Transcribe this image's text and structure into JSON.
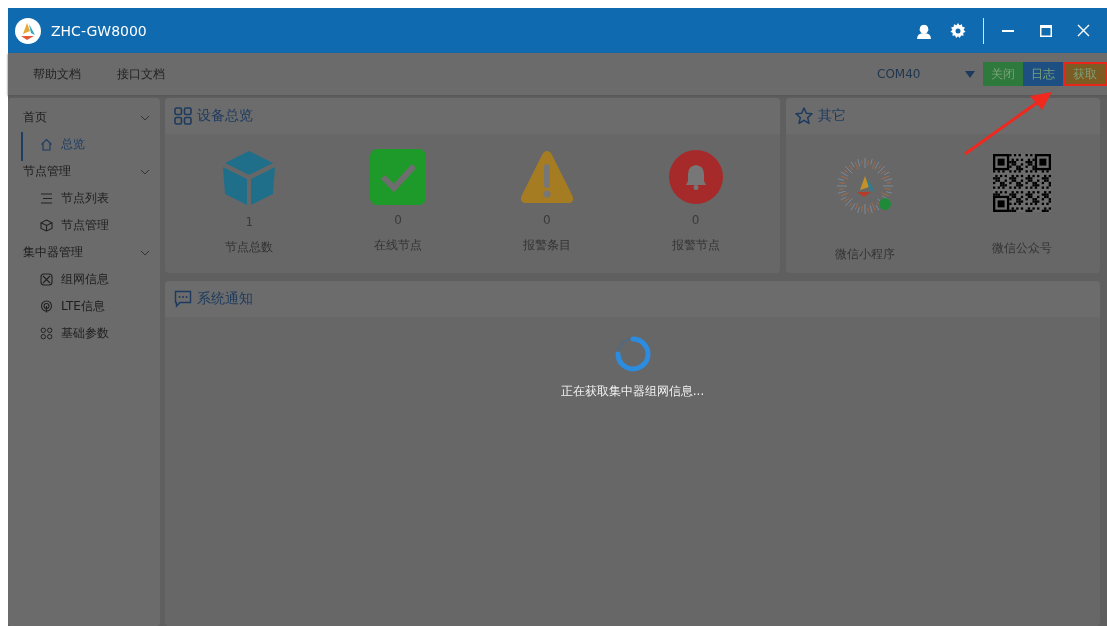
{
  "window": {
    "title": "ZHC-GW8000"
  },
  "toolbar": {
    "links": [
      "帮助文档",
      "接口文档"
    ],
    "port": {
      "value": "COM40"
    },
    "buttons": [
      {
        "label": "关闭",
        "color": "#2e7a3c",
        "highlighted": false
      },
      {
        "label": "日志",
        "color": "#1e4f82",
        "highlighted": false
      },
      {
        "label": "获取",
        "color": "#7c5c22",
        "highlighted": true
      }
    ]
  },
  "sidebar": {
    "groups": [
      {
        "label": "首页",
        "expanded": true,
        "children": [
          {
            "kind": "home",
            "label": "总览",
            "selected": true
          }
        ]
      },
      {
        "label": "节点管理",
        "expanded": true,
        "children": [
          {
            "kind": "list",
            "label": "节点列表",
            "selected": false
          },
          {
            "kind": "cube",
            "label": "节点管理",
            "selected": false
          }
        ]
      },
      {
        "label": "集中器管理",
        "expanded": true,
        "children": [
          {
            "kind": "network",
            "label": "组网信息",
            "selected": false
          },
          {
            "kind": "signal",
            "label": "LTE信息",
            "selected": false
          },
          {
            "kind": "command",
            "label": "基础参数",
            "selected": false
          }
        ]
      }
    ]
  },
  "overview": {
    "title": "设备总览",
    "stats": [
      {
        "kind": "cube",
        "value": "1",
        "label": "节点总数"
      },
      {
        "kind": "check",
        "value": "0",
        "label": "在线节点"
      },
      {
        "kind": "warning",
        "value": "0",
        "label": "报警条目"
      },
      {
        "kind": "bell",
        "value": "0",
        "label": "报警节点"
      }
    ]
  },
  "other": {
    "title": "其它",
    "items": [
      {
        "kind": "mini-program",
        "label": "微信小程序"
      },
      {
        "kind": "qr",
        "label": "微信公众号"
      }
    ]
  },
  "notice": {
    "title": "系统通知"
  },
  "loading": {
    "text": "正在获取集中器组网信息..."
  }
}
